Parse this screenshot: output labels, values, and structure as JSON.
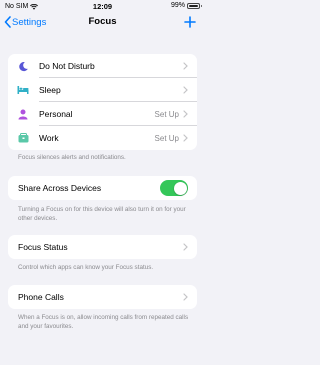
{
  "status_bar": {
    "carrier": "No SIM",
    "time": "12:09",
    "battery": "99%"
  },
  "nav": {
    "back_label": "Settings",
    "title": "Focus"
  },
  "focus_modes": [
    {
      "label": "Do Not Disturb",
      "value": "",
      "icon": "moon-icon",
      "color": "#5856d6"
    },
    {
      "label": "Sleep",
      "value": "",
      "icon": "bed-icon",
      "color": "#30b0c7"
    },
    {
      "label": "Personal",
      "value": "Set Up",
      "icon": "person-icon",
      "color": "#af52de"
    },
    {
      "label": "Work",
      "value": "Set Up",
      "icon": "work-badge-icon",
      "color": "#5ac8a8"
    }
  ],
  "focus_footer": "Focus silences alerts and notifications.",
  "share": {
    "label": "Share Across Devices",
    "enabled": true,
    "footer": "Turning a Focus on for this device will also turn it on for your other devices."
  },
  "focus_status": {
    "label": "Focus Status",
    "footer": "Control which apps can know your Focus status."
  },
  "phone_calls": {
    "label": "Phone Calls",
    "footer": "When a Focus is on, allow incoming calls from repeated calls and your favourites."
  },
  "colors": {
    "accent": "#007aff",
    "toggle_on": "#34c759"
  }
}
